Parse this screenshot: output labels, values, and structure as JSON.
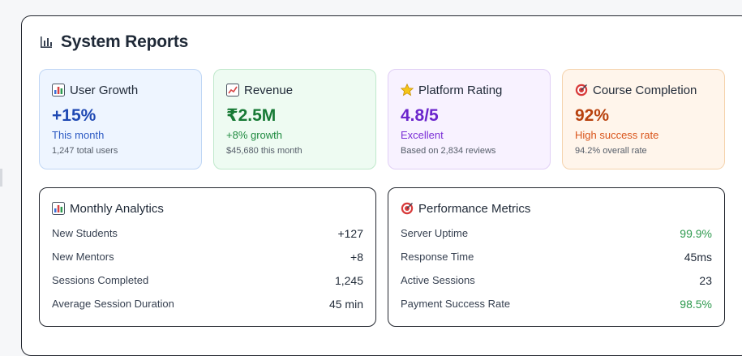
{
  "title": "System Reports",
  "cards": [
    {
      "icon": "bar-chart-icon",
      "label": "User Growth",
      "value": "+15%",
      "sub": "This month",
      "note": "1,247 total users"
    },
    {
      "icon": "trend-chart-icon",
      "label": "Revenue",
      "value": "₹2.5M",
      "sub": "+8% growth",
      "note": "$45,680 this month"
    },
    {
      "icon": "star-icon",
      "label": "Platform Rating",
      "value": "4.8/5",
      "sub": "Excellent",
      "note": "Based on 2,834 reviews"
    },
    {
      "icon": "target-icon",
      "label": "Course Completion",
      "value": "92%",
      "sub": "High success rate",
      "note": "94.2% overall rate"
    }
  ],
  "monthly": {
    "icon": "bar-chart-icon",
    "title": "Monthly Analytics",
    "rows": [
      {
        "label": "New Students",
        "value": "+127"
      },
      {
        "label": "New Mentors",
        "value": "+8"
      },
      {
        "label": "Sessions Completed",
        "value": "1,245"
      },
      {
        "label": "Average Session Duration",
        "value": "45 min"
      }
    ]
  },
  "performance": {
    "icon": "target-icon",
    "title": "Performance Metrics",
    "rows": [
      {
        "label": "Server Uptime",
        "value": "99.9%",
        "status": "good"
      },
      {
        "label": "Response Time",
        "value": "45ms",
        "status": "neutral"
      },
      {
        "label": "Active Sessions",
        "value": "23",
        "status": "neutral"
      },
      {
        "label": "Payment Success Rate",
        "value": "98.5%",
        "status": "good"
      }
    ]
  },
  "colors": {
    "blue": "#1f49b3",
    "green": "#177a35",
    "purple": "#6b25cc",
    "orange": "#b8420e",
    "good": "#2f9a4f"
  }
}
